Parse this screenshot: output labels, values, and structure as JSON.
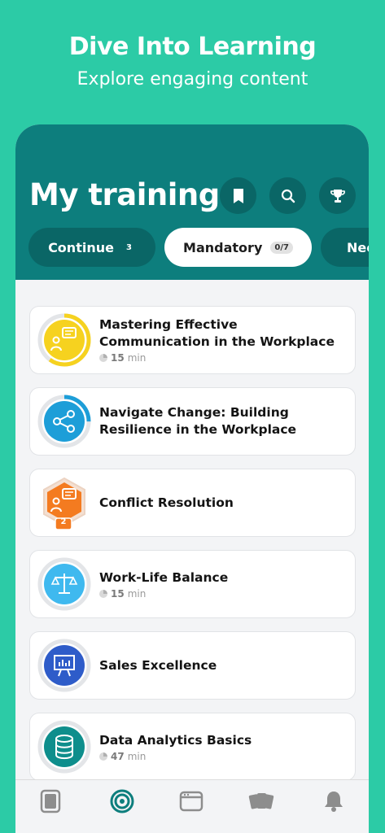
{
  "hero": {
    "title": "Dive Into Learning",
    "subtitle": "Explore engaging content"
  },
  "header": {
    "title": "My training"
  },
  "header_icons": [
    "bookmark-icon",
    "search-icon",
    "trophy-icon"
  ],
  "tabs": [
    {
      "label": "Continue",
      "count": "3",
      "state": "inactive"
    },
    {
      "label": "Mandatory",
      "count": "0/7",
      "state": "active"
    },
    {
      "label": "Nee",
      "state": "inactive"
    }
  ],
  "courses": [
    {
      "title": "Mastering Effective Communication in the Workplace",
      "duration": "15",
      "unit": "min",
      "icon": "chat-person-icon",
      "color": "#f6d21f",
      "progress_percent": 60
    },
    {
      "title": "Navigate Change: Building Resilience in the Workplace",
      "duration": "",
      "unit": "",
      "icon": "share-icon",
      "color": "#1d9ed8",
      "progress_percent": 25
    },
    {
      "title": "Conflict Resolution",
      "duration": "",
      "unit": "",
      "icon": "chat-person-icon",
      "color": "#f47b20",
      "badge": "2"
    },
    {
      "title": "Work-Life Balance",
      "duration": "15",
      "unit": "min",
      "icon": "scale-icon",
      "color": "#3fb9ef"
    },
    {
      "title": "Sales Excellence",
      "duration": "",
      "unit": "",
      "icon": "presentation-icon",
      "color": "#2e5cc9"
    },
    {
      "title": "Data Analytics Basics",
      "duration": "47",
      "unit": "min",
      "icon": "database-icon",
      "color": "#0e8e8c"
    }
  ],
  "bottom_nav": [
    "library-icon",
    "target-icon",
    "browser-icon",
    "cards-icon",
    "bell-icon"
  ],
  "colors": {
    "background": "#2ccba6",
    "header": "#0d7e7d",
    "header_dark": "#0a6666",
    "nav_active": "#0d7e7d",
    "nav_inactive": "#8d8d8d"
  }
}
